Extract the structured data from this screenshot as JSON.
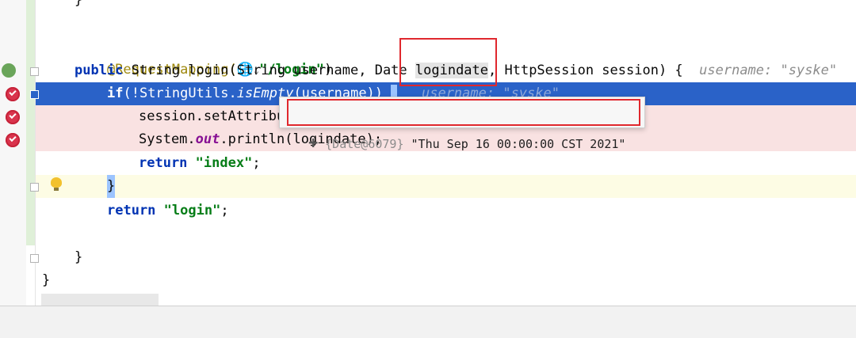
{
  "editor": {
    "lines": [
      {
        "kind": "plain",
        "text": "}"
      },
      {
        "kind": "blank",
        "text": ""
      },
      {
        "kind": "annotation",
        "annotation": "@RequestMapping(",
        "value": "\"/login\"",
        "close": ")"
      },
      {
        "kind": "signature",
        "pre": "public",
        "mid": " String login(String username, Date ",
        "param": "logindate",
        "post": ", HttpSession session) {",
        "hint": "username: \"syske\""
      },
      {
        "kind": "if",
        "pre": "if",
        "mid": "(!StringUtils.",
        "method": "isEmpty",
        "post": "(username)) ",
        "hint": "username: \"syske\""
      },
      {
        "kind": "plain",
        "text": "session.setAttribute"
      },
      {
        "kind": "println",
        "pre": "System.",
        "field": "out",
        "post": ".println(logindate);"
      },
      {
        "kind": "return",
        "kw": "return",
        "value": "\"index\"",
        "end": ";"
      },
      {
        "kind": "plain",
        "text": "}"
      },
      {
        "kind": "return",
        "kw": "return",
        "value": "\"login\"",
        "end": ";"
      },
      {
        "kind": "blank",
        "text": ""
      },
      {
        "kind": "plain",
        "text": "}"
      },
      {
        "kind": "plain",
        "text": "}"
      }
    ],
    "globe_icon": "globe-icon"
  },
  "tooltip": {
    "expand": "+",
    "object_ref": "{Date@6079}",
    "value": "\"Thu Sep 16 00:00:00 CST 2021\""
  },
  "icons": {
    "breakpoint": "breakpoint-check-icon",
    "lightbulb": "lightbulb-icon",
    "globe": "web-globe-icon"
  },
  "colors": {
    "current_line": "#2a62c8",
    "breakpoint_line": "#f9e2e2",
    "highlight_box": "#e0282e"
  }
}
